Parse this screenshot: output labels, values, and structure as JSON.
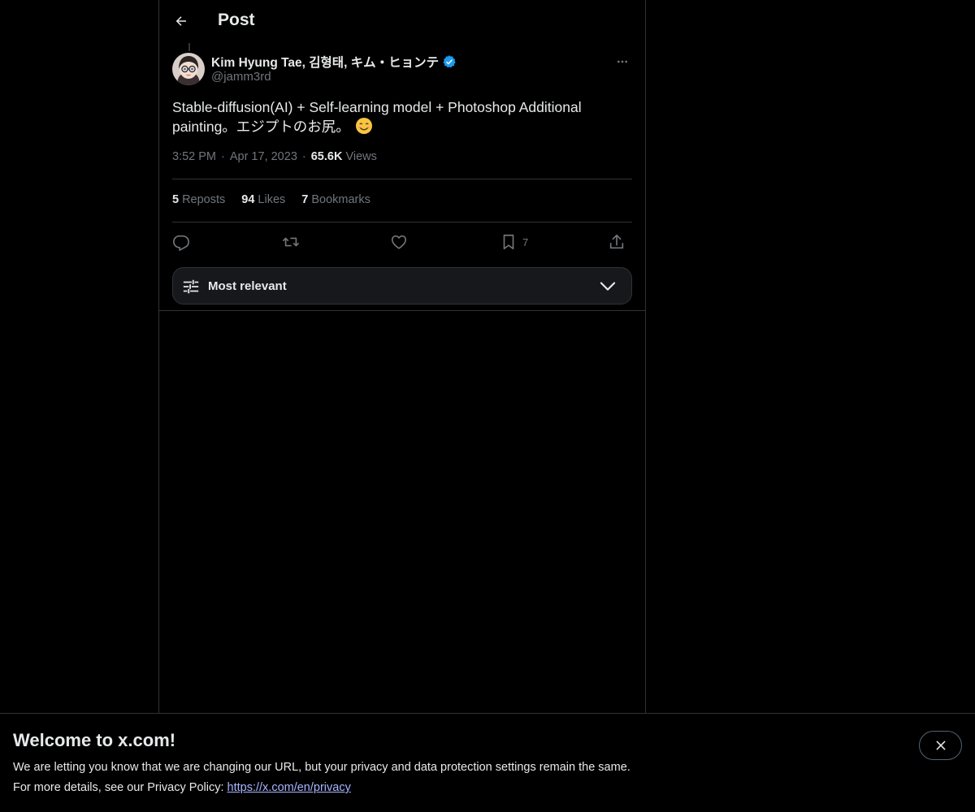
{
  "header": {
    "title": "Post"
  },
  "post": {
    "author": {
      "display_name": "Kim Hyung Tae, 김형태, キム・ヒョンテ",
      "handle": "@jamm3rd",
      "verified": true
    },
    "text": "Stable-diffusion(AI) + Self-learning model + Photoshop Additional painting。エジプトのお尻。",
    "emoji": "smiling-face-emoji",
    "time": "3:52 PM",
    "date": "Apr 17, 2023",
    "views_count": "65.6K",
    "views_label": "Views",
    "separator": "·"
  },
  "stats": {
    "reposts": {
      "count": "5",
      "label": "Reposts"
    },
    "likes": {
      "count": "94",
      "label": "Likes"
    },
    "bookmarks": {
      "count": "7",
      "label": "Bookmarks"
    }
  },
  "actions": {
    "reply_icon": "reply-icon",
    "repost_icon": "repost-icon",
    "like_icon": "heart-icon",
    "bookmark_icon": "bookmark-icon",
    "bookmark_count": "7",
    "share_icon": "share-icon"
  },
  "sort": {
    "label": "Most relevant",
    "icon": "sliders-icon"
  },
  "banner": {
    "title": "Welcome to x.com!",
    "line1": "We are letting you know that we are changing our URL, but your privacy and data protection settings remain the same.",
    "line2_prefix": "For more details, see our Privacy Policy: ",
    "link": "https://x.com/en/privacy"
  },
  "colors": {
    "background": "#000000",
    "text": "#e7e9ea",
    "muted": "#71767b",
    "border": "#2f3336",
    "verified": "#1d9bf0",
    "link": "#a9b4ff"
  }
}
